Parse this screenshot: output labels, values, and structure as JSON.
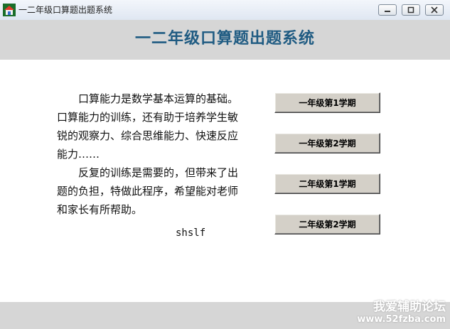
{
  "window": {
    "title": "一二年级口算题出题系统"
  },
  "header": {
    "title": "一二年级口算题出题系统"
  },
  "intro": {
    "paragraphs": [
      "口算能力是数学基本运算的基础。口算能力的训练，还有助于培养学生敏锐的观察力、综合思维能力、快速反应能力……",
      "反复的训练是需要的，但带来了出题的负担，特做此程序，希望能对老师和家长有所帮助。"
    ],
    "author": "shslf"
  },
  "buttons": {
    "grade1_term1": "一年级第1学期",
    "grade1_term2": "一年级第2学期",
    "grade2_term1": "二年级第1学期",
    "grade2_term2": "二年级第2学期"
  },
  "watermark": {
    "text": "我爱辅助论坛",
    "url": "www.52fzba.com"
  },
  "colors": {
    "header_title": "#1f5b82",
    "band_gray": "#d6d6d6",
    "button_face": "#d4d0c8"
  }
}
